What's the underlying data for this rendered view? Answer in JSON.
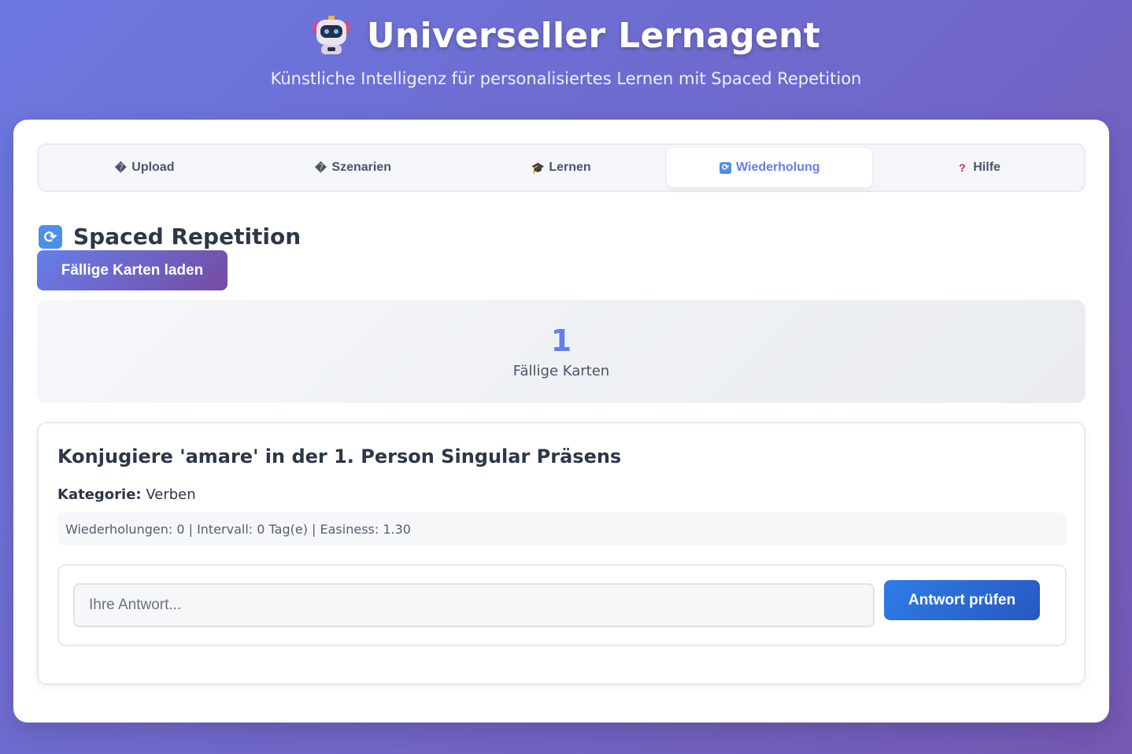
{
  "header": {
    "title": "Universeller Lernagent",
    "subtitle": "Künstliche Intelligenz für personalisiertes Lernen mit Spaced Repetition"
  },
  "tabs": [
    {
      "label": "Upload",
      "icon": "�",
      "icon_name": "upload-icon"
    },
    {
      "label": "Szenarien",
      "icon": "�",
      "icon_name": "scenarios-icon"
    },
    {
      "label": "Lernen",
      "icon": "🎓",
      "icon_name": "graduation-cap-icon"
    },
    {
      "label": "Wiederholung",
      "icon": "🔄",
      "icon_name": "repeat-icon",
      "active": true
    },
    {
      "label": "Hilfe",
      "icon": "❓",
      "icon_name": "question-icon"
    }
  ],
  "section": {
    "title": "Spaced Repetition",
    "icon": "🔄",
    "load_button": "Fällige Karten laden"
  },
  "stats": {
    "due_count": "1",
    "due_label": "Fällige Karten"
  },
  "card": {
    "question": "Konjugiere 'amare' in der 1. Person Singular Präsens",
    "category_label": "Kategorie:",
    "category_value": "Verben",
    "meta": "Wiederholungen: 0 | Intervall: 0 Tag(e) | Easiness: 1.30",
    "answer_placeholder": "Ihre Antwort...",
    "answer_value": "",
    "check_button": "Antwort prüfen"
  },
  "colors": {
    "accent": "#667eea",
    "gradient_start": "#667eea",
    "gradient_end": "#764ba2",
    "check_button": "#2f7de8"
  }
}
